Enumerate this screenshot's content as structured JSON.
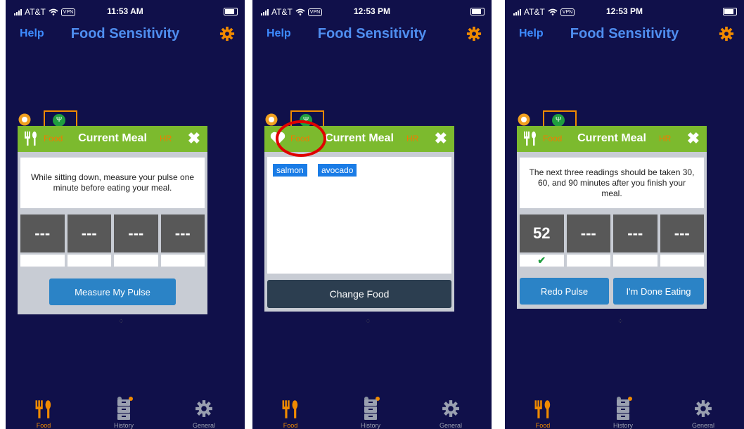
{
  "screens": [
    {
      "status": {
        "carrier": "AT&T",
        "vpn": "VPN",
        "time": "11:53 AM"
      },
      "nav": {
        "help": "Help",
        "title": "Food Sensitivity"
      },
      "card": {
        "food_label": "Food",
        "title": "Current Meal",
        "hr_label": "HR",
        "close": "✖"
      },
      "instruction": "While sitting down, measure your pulse one minute before eating your meal.",
      "readings": [
        "---",
        "---",
        "---",
        "---"
      ],
      "button": "Measure My Pulse",
      "tabs": [
        "Food",
        "History",
        "General"
      ]
    },
    {
      "status": {
        "carrier": "AT&T",
        "vpn": "VPN",
        "time": "12:53 PM"
      },
      "nav": {
        "help": "Help",
        "title": "Food Sensitivity"
      },
      "card": {
        "food_label": "Food",
        "title": "Current Meal",
        "hr_label": "HR",
        "close": "✖"
      },
      "foods": [
        "salmon",
        "avocado"
      ],
      "button": "Change Food",
      "tabs": [
        "Food",
        "History",
        "General"
      ]
    },
    {
      "status": {
        "carrier": "AT&T",
        "vpn": "VPN",
        "time": "12:53 PM"
      },
      "nav": {
        "help": "Help",
        "title": "Food Sensitivity"
      },
      "card": {
        "food_label": "Food",
        "title": "Current Meal",
        "hr_label": "HR",
        "close": "✖"
      },
      "instruction": "The next three readings should be taken 30, 60, and 90 minutes after you finish your meal.",
      "readings": [
        "52",
        "---",
        "---",
        "---"
      ],
      "reading_checks": [
        "✔",
        "",
        "",
        ""
      ],
      "buttons": {
        "redo": "Redo Pulse",
        "done": "I'm Done Eating"
      },
      "tabs": [
        "Food",
        "History",
        "General"
      ]
    }
  ],
  "colors": {
    "background": "#10104a",
    "accent": "#f08a00",
    "header_green": "#7cba2e",
    "button_blue": "#2b83c6",
    "highlight_red": "#e00000"
  },
  "icons": [
    "signal-icon",
    "wifi-icon",
    "battery-icon",
    "gear-icon",
    "sun-icon",
    "fork-knife-icon",
    "heart-icon",
    "close-icon",
    "check-icon",
    "history-icon"
  ]
}
